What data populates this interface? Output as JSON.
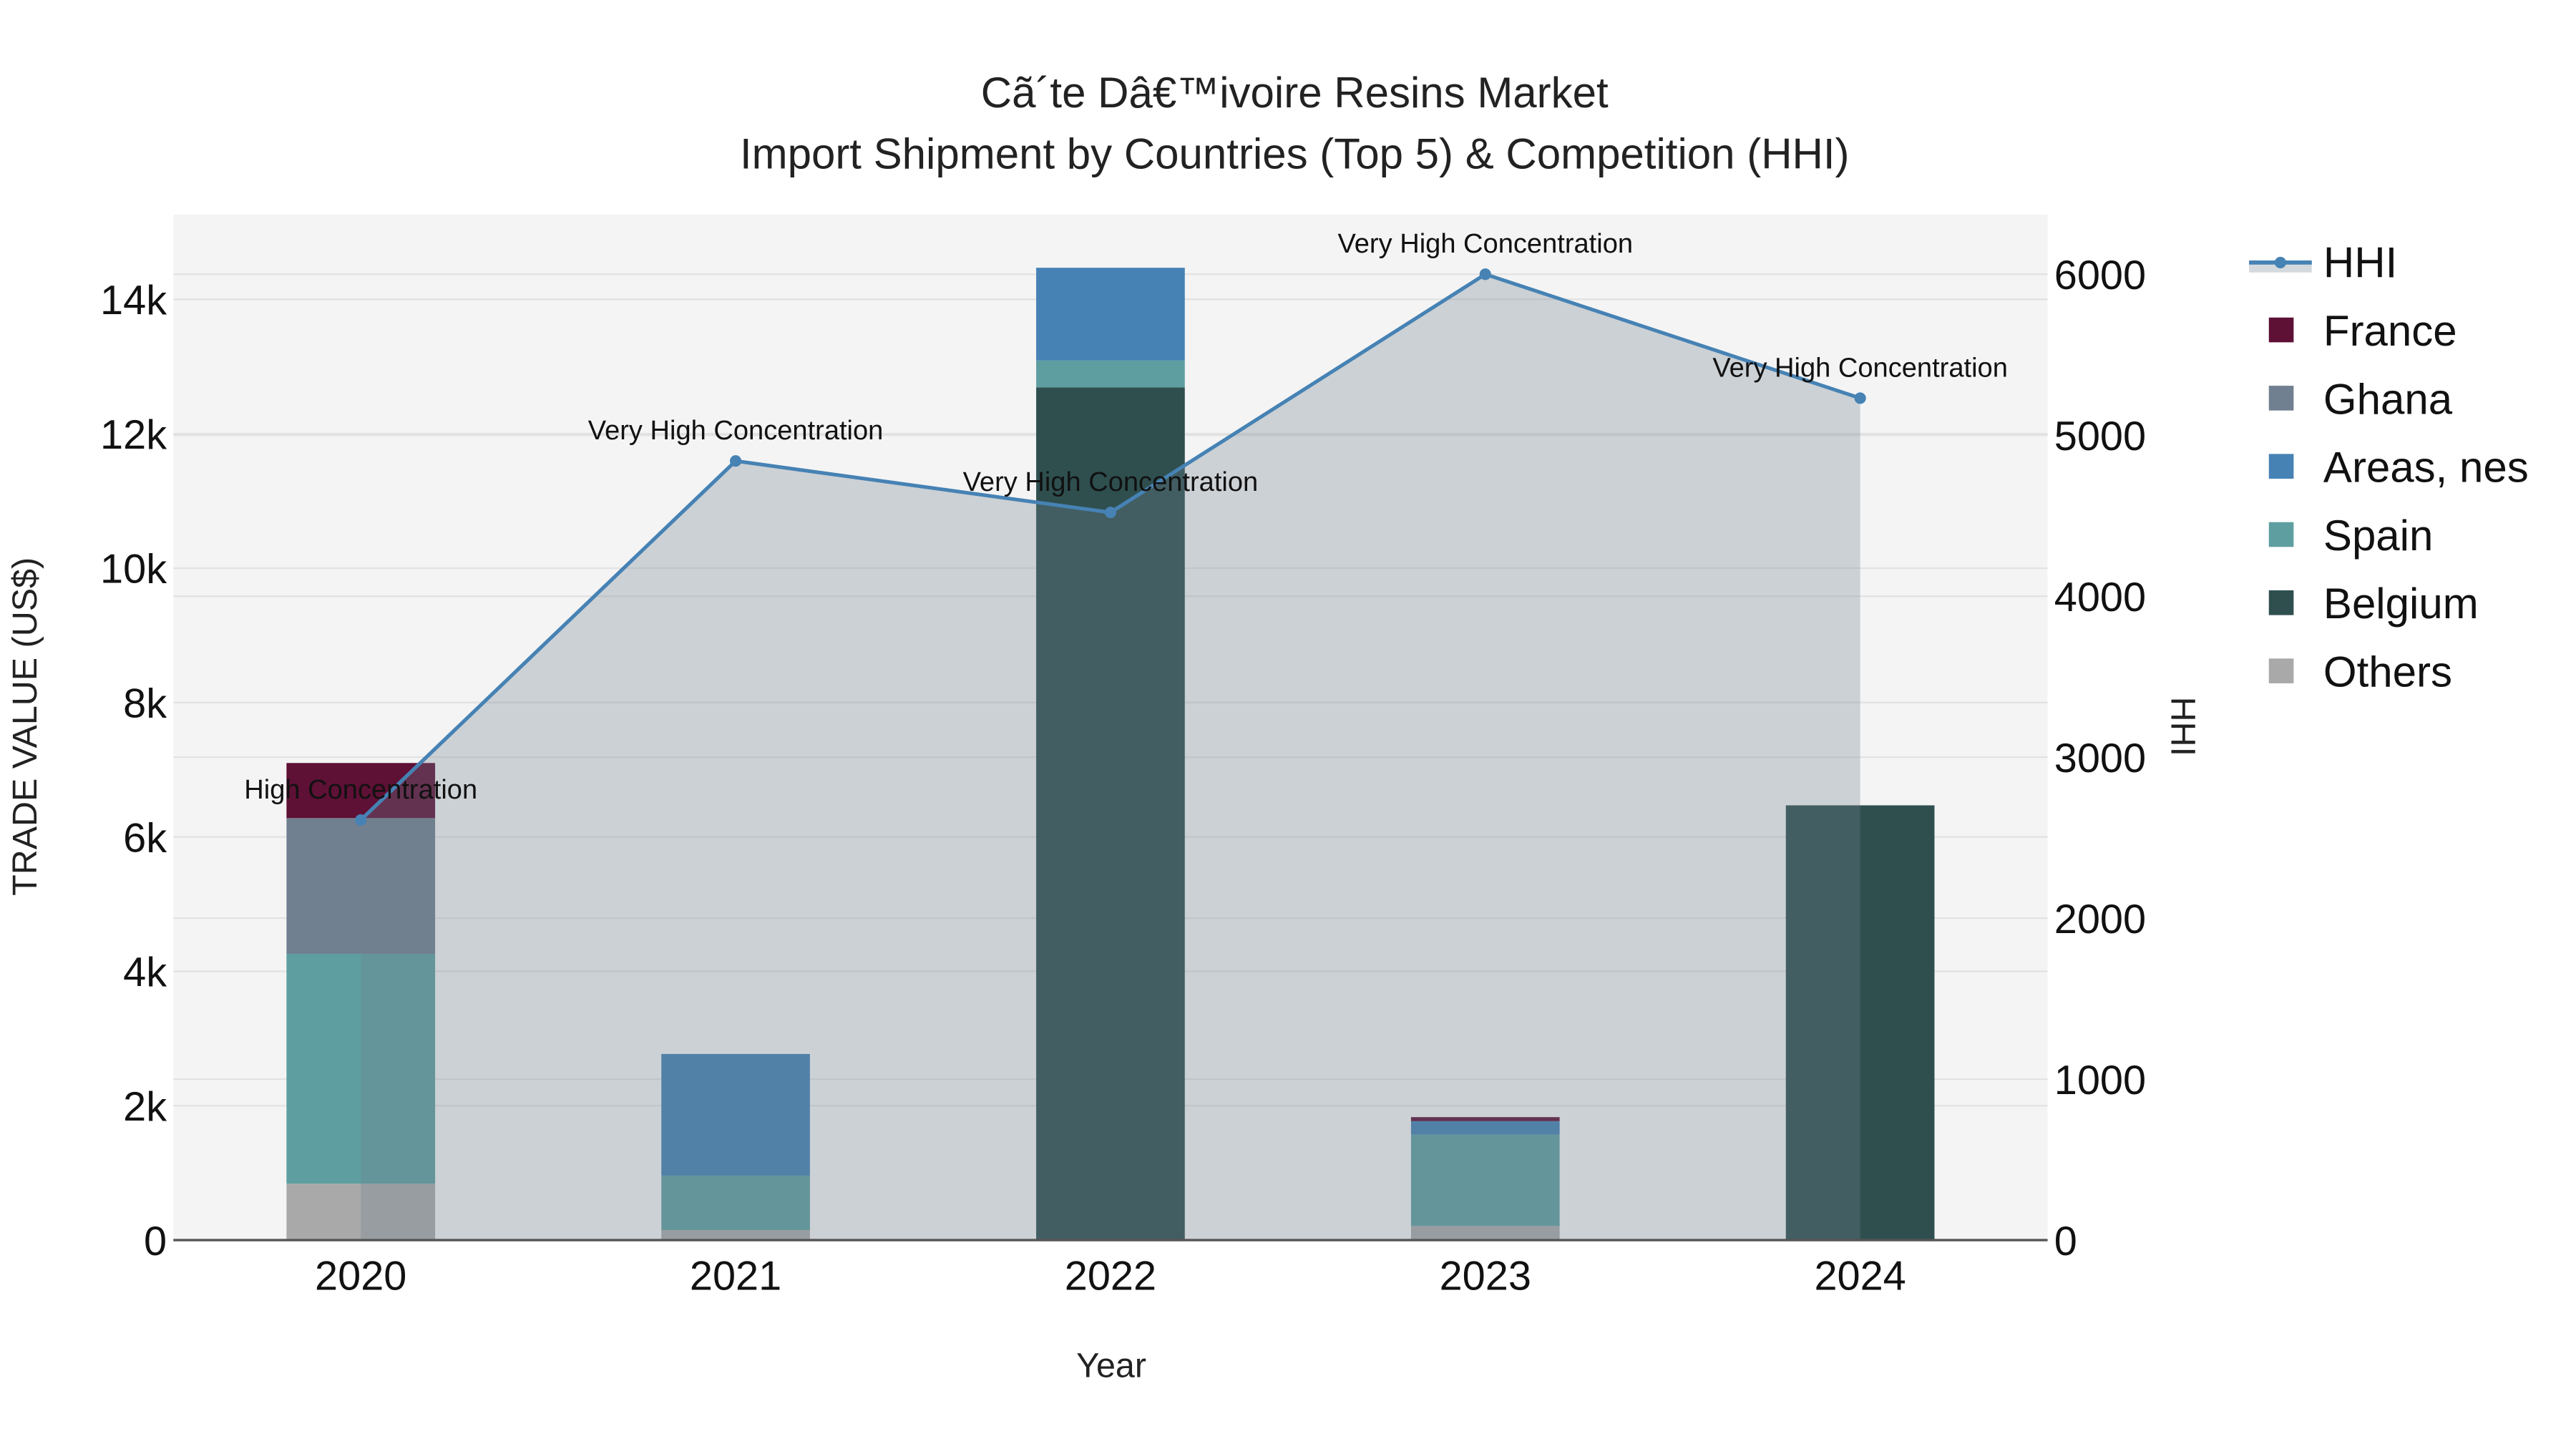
{
  "chart_data": {
    "type": "bar",
    "title": "Cã´te Dâ€™ivoire Resins Market",
    "subtitle": "Import Shipment by Countries (Top 5) & Competition (HHI)",
    "xlabel": "Year",
    "ylabel": "TRADE VALUE (US$)",
    "y2label": "HHI",
    "categories": [
      "2020",
      "2021",
      "2022",
      "2023",
      "2024"
    ],
    "stacked": true,
    "ylim": [
      0,
      15260
    ],
    "y2lim": [
      0,
      6370
    ],
    "yticks": [
      0,
      2000,
      4000,
      6000,
      8000,
      10000,
      12000,
      14000
    ],
    "yticklabels": [
      "0",
      "2k",
      "4k",
      "6k",
      "8k",
      "10k",
      "12k",
      "14k"
    ],
    "y2ticks": [
      0,
      1000,
      2000,
      3000,
      4000,
      5000,
      6000
    ],
    "y2ticklabels": [
      "0",
      "1000",
      "2000",
      "3000",
      "4000",
      "5000",
      "6000"
    ],
    "grid": true,
    "legend_position": "right",
    "series": [
      {
        "name": "Others",
        "color": "#a9a9a9",
        "values": [
          840,
          150,
          0,
          210,
          0
        ]
      },
      {
        "name": "Belgium",
        "color": "#2f4f4f",
        "values": [
          0,
          0,
          12690,
          0,
          6470
        ]
      },
      {
        "name": "Spain",
        "color": "#5f9ea0",
        "values": [
          3420,
          810,
          400,
          1360,
          0
        ]
      },
      {
        "name": "Areas, nes",
        "color": "#4682b4",
        "values": [
          0,
          1810,
          1380,
          200,
          0
        ]
      },
      {
        "name": "Ghana",
        "color": "#708090",
        "values": [
          2020,
          0,
          0,
          0,
          0
        ]
      },
      {
        "name": "France",
        "color": "#5e1035",
        "values": [
          820,
          0,
          0,
          60,
          0
        ]
      }
    ],
    "hhi": {
      "name": "HHI",
      "color": "#4682b4",
      "values": [
        2610,
        4840,
        4520,
        6000,
        5230
      ],
      "annotations": [
        "High Concentration",
        "Very High Concentration",
        "Very High Concentration",
        "Very High Concentration",
        "Very High Concentration"
      ]
    },
    "legend_order": [
      "HHI",
      "France",
      "Ghana",
      "Areas, nes",
      "Spain",
      "Belgium",
      "Others"
    ]
  }
}
